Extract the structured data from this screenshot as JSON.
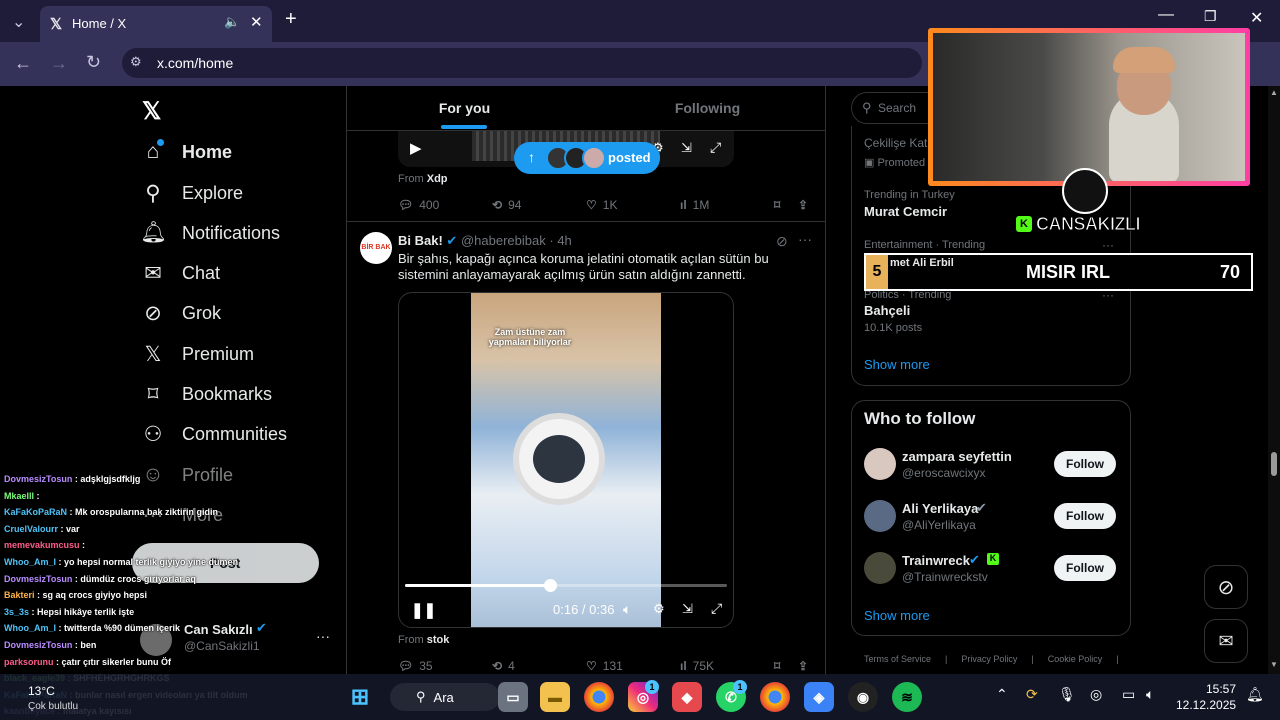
{
  "browser": {
    "tab_title": "Home / X",
    "url": "x.com/home"
  },
  "nav": {
    "items": [
      {
        "label": "Home",
        "icon": "home-icon"
      },
      {
        "label": "Explore",
        "icon": "search-icon"
      },
      {
        "label": "Notifications",
        "icon": "bell-icon"
      },
      {
        "label": "Chat",
        "icon": "mail-icon"
      },
      {
        "label": "Grok",
        "icon": "grok-icon"
      },
      {
        "label": "Premium",
        "icon": "x-logo-icon"
      },
      {
        "label": "Bookmarks",
        "icon": "bookmark-icon"
      },
      {
        "label": "Communities",
        "icon": "people-icon"
      },
      {
        "label": "Profile",
        "icon": "person-icon"
      },
      {
        "label": "More",
        "icon": "more-circle-icon"
      }
    ],
    "post_button": "Post",
    "account": {
      "name": "Can Sakızlı",
      "handle": "@CanSakizli1"
    }
  },
  "feed": {
    "tabs": [
      "For you",
      "Following"
    ],
    "posted_pill": "posted",
    "tweet1": {
      "from_label": "From",
      "from_source": "Xdp",
      "replies": "400",
      "reposts": "94",
      "likes": "1K",
      "views": "1M"
    },
    "tweet2": {
      "name": "Bi Bak!",
      "handle": "@haberebibak",
      "time": "4h",
      "avatar_text": "BİR BAK",
      "text": "Bir şahıs, kapağı açınca koruma jelatini otomatik açılan sütün bu sistemini anlayamayarak açılmış ürün satın aldığını zannetti.",
      "video_caption": "Zam üstüne zam yapmaları biliyorlar",
      "video_time": "0:16 / 0:36",
      "progress": 0.45,
      "from_label": "From",
      "from_source": "stok",
      "replies": "35",
      "reposts": "4",
      "likes": "131",
      "views": "75K"
    }
  },
  "sidebar": {
    "search_placeholder": "Search",
    "trends": [
      {
        "small": "Çekilişe Katıl",
        "big": "",
        "meta": "Promoted"
      },
      {
        "small": "Trending in Turkey",
        "big": "Murat Cemcir",
        "meta": ""
      },
      {
        "small": "Entertainment · Trending",
        "big": "met Ali Erbil",
        "meta": ""
      },
      {
        "small": "Politics · Trending",
        "big": "Bahçeli",
        "meta": "10.1K posts"
      }
    ],
    "show_more": "Show more",
    "who_to_follow": {
      "title": "Who to follow",
      "users": [
        {
          "name": "zampara seyfettin",
          "handle": "@eroscawcixyx",
          "button": "Follow"
        },
        {
          "name": "Ali Yerlikaya",
          "handle": "@AliYerlikaya",
          "button": "Follow"
        },
        {
          "name": "Trainwreck",
          "handle": "@Trainwreckstv",
          "button": "Follow"
        }
      ],
      "show_more": "Show more"
    },
    "footer": [
      "Terms of Service",
      "Privacy Policy",
      "Cookie Policy"
    ]
  },
  "stream_overlay": {
    "streamer_name": "CANSAKIZLI",
    "ranking": {
      "position": "5",
      "label": "MISIR IRL",
      "score": "70"
    }
  },
  "chat": [
    {
      "user": "DovmesizTosun",
      "msg": "adşklgjsdfkljg",
      "color": "#b98cff"
    },
    {
      "user": "Mkaelll",
      "msg": "",
      "color": "#7cfc7c"
    },
    {
      "user": "KaFaKoPaRaN",
      "msg": "Mk orospularına bak ziktirin gidin",
      "color": "#4fc3f7"
    },
    {
      "user": "CruelValourr",
      "msg": "var",
      "color": "#4fc3f7"
    },
    {
      "user": "memevakumcusu",
      "msg": "",
      "color": "#ff5c8a"
    },
    {
      "user": "Whoo_Am_I",
      "msg": "yo hepsi normal terlik giyiyo yine dümen",
      "color": "#4fc3f7"
    },
    {
      "user": "DovmesizTosun",
      "msg": "dümdüz crocs giriyorlar aq",
      "color": "#b98cff"
    },
    {
      "user": "Bakteri",
      "msg": "sg aq crocs giyiyo hepsi",
      "color": "#ffb347"
    },
    {
      "user": "3s_3s",
      "msg": "Hepsi hikâye terlik işte",
      "color": "#4fc3f7"
    },
    {
      "user": "Whoo_Am_I",
      "msg": "twitterda %90 dümen içerik",
      "color": "#4fc3f7"
    },
    {
      "user": "DovmesizTosun",
      "msg": "ben",
      "color": "#b98cff"
    },
    {
      "user": "parksorunu",
      "msg": "çatır çıtır sikerler bunu Öf",
      "color": "#ff5c8a"
    },
    {
      "user": "black_eagle39",
      "msg": "SHFHEHGRHGHRKGS",
      "color": "#7cfc7c"
    },
    {
      "user": "KaFaKoPaRaN",
      "msg": "bunlar nasıl ergen videoları ya tilt oldum",
      "color": "#4fc3f7"
    },
    {
      "user": "kaanbeylice",
      "msg": "malatya kayısısı",
      "color": "#b98cff"
    }
  ],
  "taskbar": {
    "search_label": "Ara",
    "weather_temp": "13°C",
    "weather_desc": "Çok bulutlu",
    "time": "15:57",
    "date": "12.12.2025",
    "badges": {
      "instagram": "1",
      "whatsapp": "1"
    }
  }
}
